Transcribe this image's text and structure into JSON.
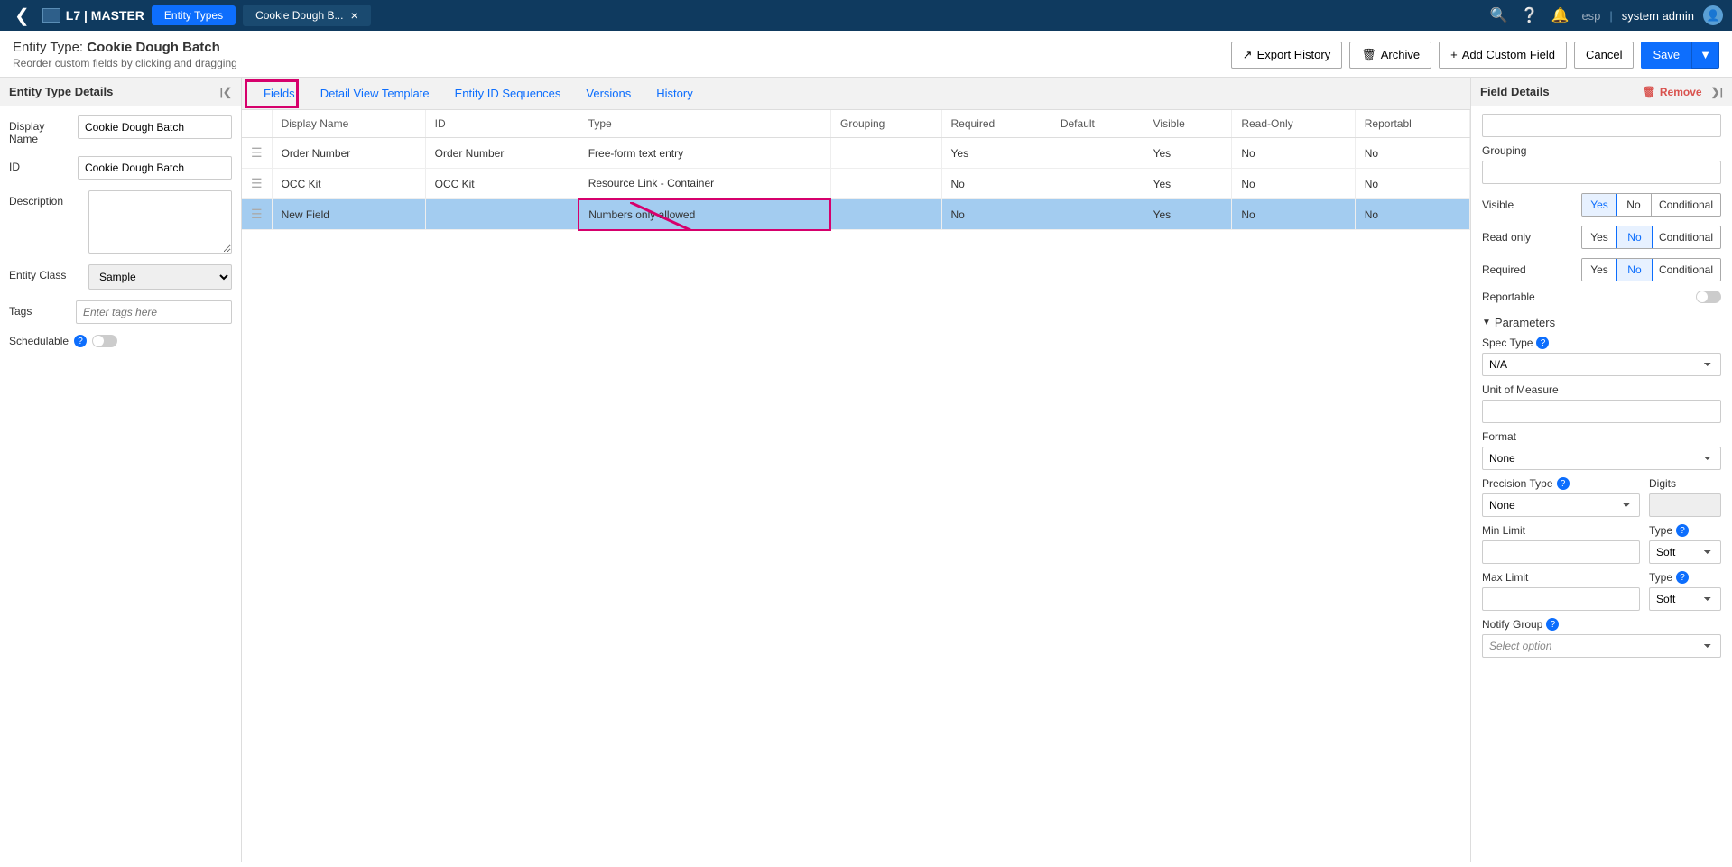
{
  "topbar": {
    "logo": "L7 | MASTER",
    "entity_types_btn": "Entity Types",
    "tab_label": "Cookie Dough B...",
    "esp": "esp",
    "user": "system admin"
  },
  "pagehead": {
    "prefix": "Entity Type: ",
    "name": "Cookie Dough Batch",
    "subtitle": "Reorder custom fields by clicking and dragging",
    "export": "Export History",
    "archive": "Archive",
    "add_field": "Add Custom Field",
    "cancel": "Cancel",
    "save": "Save"
  },
  "leftpanel": {
    "title": "Entity Type Details",
    "display_name_label": "Display Name",
    "display_name": "Cookie Dough Batch",
    "id_label": "ID",
    "id": "Cookie Dough Batch",
    "description_label": "Description",
    "description": "",
    "entity_class_label": "Entity Class",
    "entity_class": "Sample",
    "tags_label": "Tags",
    "tags_placeholder": "Enter tags here",
    "schedulable": "Schedulable"
  },
  "tabs": {
    "fields": "Fields",
    "detail_view": "Detail View Template",
    "id_seq": "Entity ID Sequences",
    "versions": "Versions",
    "history": "History"
  },
  "grid": {
    "headers": {
      "display_name": "Display Name",
      "id": "ID",
      "type": "Type",
      "grouping": "Grouping",
      "required": "Required",
      "default": "Default",
      "visible": "Visible",
      "readonly": "Read-Only",
      "reportable": "Reportabl"
    },
    "rows": [
      {
        "display_name": "Order Number",
        "id": "Order Number",
        "type": "Free-form text entry",
        "grouping": "",
        "required": "Yes",
        "default": "",
        "visible": "Yes",
        "readonly": "No",
        "reportable": "No"
      },
      {
        "display_name": "OCC Kit",
        "id": "OCC Kit",
        "type": "Resource Link - Container",
        "grouping": "",
        "required": "No",
        "default": "",
        "visible": "Yes",
        "readonly": "No",
        "reportable": "No"
      },
      {
        "display_name": "New Field",
        "id": "",
        "type": "Numbers only allowed",
        "grouping": "",
        "required": "No",
        "default": "",
        "visible": "Yes",
        "readonly": "No",
        "reportable": "No"
      }
    ]
  },
  "rightpanel": {
    "title": "Field Details",
    "remove": "Remove",
    "grouping_label": "Grouping",
    "visible_label": "Visible",
    "readonly_label": "Read only",
    "required_label": "Required",
    "reportable_label": "Reportable",
    "opts": {
      "yes": "Yes",
      "no": "No",
      "conditional": "Conditional"
    },
    "parameters": "Parameters",
    "spec_type_label": "Spec Type",
    "spec_type": "N/A",
    "unit_label": "Unit of Measure",
    "format_label": "Format",
    "format": "None",
    "precision_type_label": "Precision Type",
    "precision_type": "None",
    "digits_label": "Digits",
    "min_limit_label": "Min Limit",
    "max_limit_label": "Max Limit",
    "type_label": "Type",
    "limit_type": "Soft",
    "notify_group_label": "Notify Group",
    "notify_placeholder": "Select option"
  }
}
